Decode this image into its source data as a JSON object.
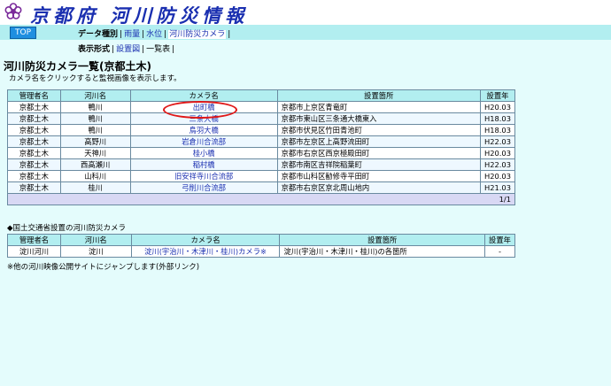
{
  "header": {
    "site_title": "京都府 河川防災情報",
    "top_button": "TOP",
    "nav_data_type_label": "データ種別",
    "nav_items": [
      "雨量",
      "水位",
      "河川防災カメラ"
    ],
    "nav_display_label": "表示形式",
    "nav_display_items": [
      "設置図",
      "一覧表"
    ]
  },
  "page": {
    "title": "河川防災カメラ一覧(京都土木)",
    "subtitle": "カメラ名をクリックすると監視画像を表示します。"
  },
  "table1": {
    "headers": [
      "管理者名",
      "河川名",
      "カメラ名",
      "設置箇所",
      "設置年"
    ],
    "rows": [
      [
        "京都土木",
        "鴨川",
        "出町橋",
        "京都市上京区青竜町",
        "H20.03"
      ],
      [
        "京都土木",
        "鴨川",
        "三条大橋",
        "京都市東山区三条通大橋東入",
        "H18.03"
      ],
      [
        "京都土木",
        "鴨川",
        "鳥羽大橋",
        "京都市伏見区竹田青池町",
        "H18.03"
      ],
      [
        "京都土木",
        "高野川",
        "岩倉川合流部",
        "京都市左京区上高野流田町",
        "H22.03"
      ],
      [
        "京都土木",
        "天神川",
        "桂小橋",
        "京都市右京区西京極殿田町",
        "H20.03"
      ],
      [
        "京都土木",
        "西高瀬川",
        "稲村橋",
        "京都市南区吉祥院稲葉町",
        "H22.03"
      ],
      [
        "京都土木",
        "山科川",
        "旧安祥寺川合流部",
        "京都市山科区勧修寺平田町",
        "H20.03"
      ],
      [
        "京都土木",
        "桂川",
        "弓削川合流部",
        "京都市右京区京北周山地内",
        "H21.03"
      ]
    ],
    "page_indicator": "1/1"
  },
  "section2": {
    "title": "◆国土交通省設置の河川防災カメラ",
    "headers": [
      "管理者名",
      "河川名",
      "カメラ名",
      "設置箇所",
      "設置年"
    ],
    "rows": [
      [
        "淀川河川",
        "淀川",
        "淀川(宇治川・木津川・桂川)カメラ※",
        "淀川(宇治川・木津川・桂川)の各箇所",
        "-"
      ]
    ],
    "note": "※他の河川映像公開サイトにジャンプします(外部リンク)"
  },
  "colors": {
    "link": "#1a2fb0",
    "highlight_ellipse": "#e01818",
    "header_bg": "#b2eef0"
  }
}
